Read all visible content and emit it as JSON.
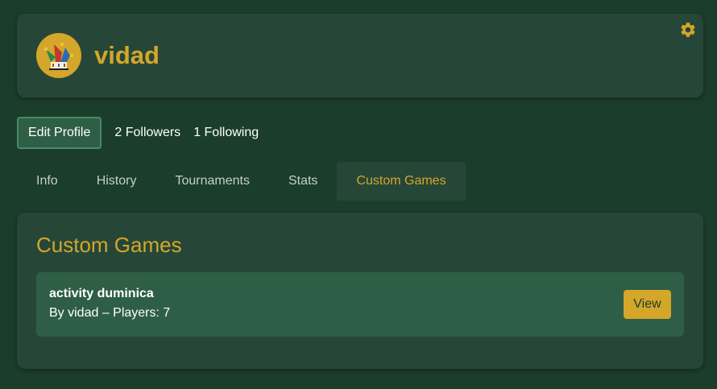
{
  "profile": {
    "username": "vidad",
    "avatar_icon": "jester-hat-icon",
    "settings_icon": "gear-icon"
  },
  "actions": {
    "edit_profile_label": "Edit Profile",
    "followers_text": "2 Followers",
    "following_text": "1 Following"
  },
  "tabs": [
    {
      "label": "Info",
      "active": false
    },
    {
      "label": "History",
      "active": false
    },
    {
      "label": "Tournaments",
      "active": false
    },
    {
      "label": "Stats",
      "active": false
    },
    {
      "label": "Custom Games",
      "active": true
    }
  ],
  "custom_games": {
    "title": "Custom Games",
    "items": [
      {
        "name": "activity duminica",
        "meta": "By vidad – Players: 7",
        "action_label": "View"
      }
    ]
  },
  "colors": {
    "background": "#1b3d2b",
    "card": "#264738",
    "accent": "#d4a62a",
    "item": "#2e5e45"
  }
}
